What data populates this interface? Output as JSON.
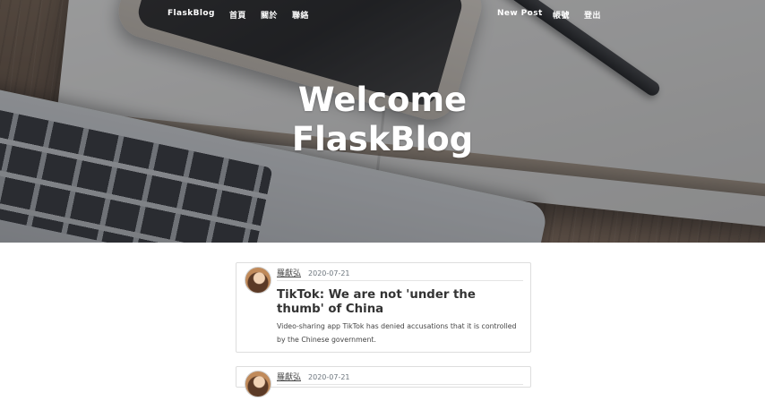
{
  "nav": {
    "brand": "FlaskBlog",
    "home": "首頁",
    "about": "關於",
    "contact": "聯絡",
    "new_post": "New Post",
    "account": "帳號",
    "logout": "登出"
  },
  "hero": {
    "line1": "Welcome",
    "line2": "FlaskBlog"
  },
  "posts": [
    {
      "author": "羅獻弘",
      "date": "2020-07-21",
      "title": "TikTok: We are not 'under the thumb' of China",
      "excerpt": "Video-sharing app TikTok has denied accusations that it is controlled by the Chinese government."
    },
    {
      "author": "羅獻弘",
      "date": "2020-07-21"
    }
  ],
  "colors": {
    "nav_text": "#ffffff",
    "title_text": "#333333",
    "muted_text": "#6c757d",
    "card_border": "#dddddd"
  },
  "icons": {
    "avatar": "user-avatar"
  }
}
